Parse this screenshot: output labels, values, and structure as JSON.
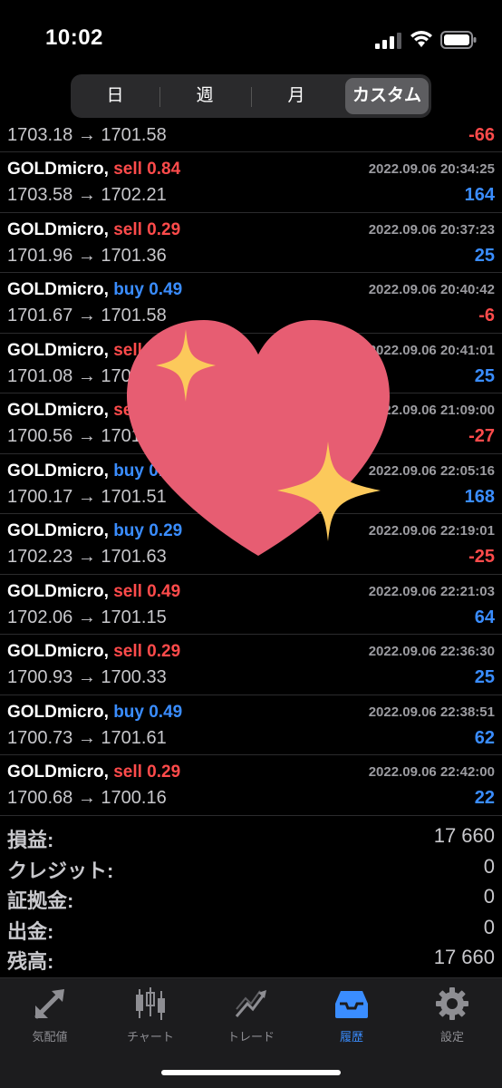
{
  "status_bar": {
    "time": "10:02"
  },
  "segments": [
    {
      "label": "日",
      "active": false
    },
    {
      "label": "週",
      "active": false
    },
    {
      "label": "月",
      "active": false
    },
    {
      "label": "カスタム",
      "active": true
    }
  ],
  "first_row": {
    "prices": "1703.18 → 1701.58",
    "pnl": "-66"
  },
  "trades": [
    {
      "symbol": "GOLDmicro,",
      "side": "sell 0.84",
      "side_type": "sell",
      "time": "2022.09.06 20:34:25",
      "prices": "1703.58 → 1702.21",
      "pnl": "164"
    },
    {
      "symbol": "GOLDmicro,",
      "side": "sell 0.29",
      "side_type": "sell",
      "time": "2022.09.06 20:37:23",
      "prices": "1701.96 → 1701.36",
      "pnl": "25"
    },
    {
      "symbol": "GOLDmicro,",
      "side": "buy 0.49",
      "side_type": "buy",
      "time": "2022.09.06 20:40:42",
      "prices": "1701.67 → 1701.58",
      "pnl": "-6"
    },
    {
      "symbol": "GOLDmicro,",
      "side": "sell 0.29",
      "side_type": "sell",
      "time": "2022.09.06 20:41:01",
      "prices": "1701.08 → 1700.48",
      "pnl": "25"
    },
    {
      "symbol": "GOLDmicro,",
      "side": "sell 0.49",
      "side_type": "sell",
      "time": "2022.09.06 21:09:00",
      "prices": "1700.56 → 1701.11",
      "pnl": "-27"
    },
    {
      "symbol": "GOLDmicro,",
      "side": "buy 0.29",
      "side_type": "buy",
      "time": "2022.09.06 22:05:16",
      "prices": "1700.17 → 1701.51",
      "pnl": "168"
    },
    {
      "symbol": "GOLDmicro,",
      "side": "buy 0.29",
      "side_type": "buy",
      "time": "2022.09.06 22:19:01",
      "prices": "1702.23 → 1701.63",
      "pnl": "-25"
    },
    {
      "symbol": "GOLDmicro,",
      "side": "sell 0.49",
      "side_type": "sell",
      "time": "2022.09.06 22:21:03",
      "prices": "1702.06 → 1701.15",
      "pnl": "64"
    },
    {
      "symbol": "GOLDmicro,",
      "side": "sell 0.29",
      "side_type": "sell",
      "time": "2022.09.06 22:36:30",
      "prices": "1700.93 → 1700.33",
      "pnl": "25"
    },
    {
      "symbol": "GOLDmicro,",
      "side": "buy 0.49",
      "side_type": "buy",
      "time": "2022.09.06 22:38:51",
      "prices": "1700.73 → 1701.61",
      "pnl": "62"
    },
    {
      "symbol": "GOLDmicro,",
      "side": "sell 0.29",
      "side_type": "sell",
      "time": "2022.09.06 22:42:00",
      "prices": "1700.68 → 1700.16",
      "pnl": "22"
    }
  ],
  "summary": [
    {
      "label": "損益:",
      "value": "17 660"
    },
    {
      "label": "クレジット:",
      "value": "0"
    },
    {
      "label": "証拠金:",
      "value": "0"
    },
    {
      "label": "出金:",
      "value": "0"
    },
    {
      "label": "残高:",
      "value": "17 660"
    }
  ],
  "tabs": [
    {
      "label": "気配値",
      "icon": "quotes-arrows-icon",
      "active": false
    },
    {
      "label": "チャート",
      "icon": "candlestick-chart-icon",
      "active": false
    },
    {
      "label": "トレード",
      "icon": "trade-trend-icon",
      "active": false
    },
    {
      "label": "履歴",
      "icon": "history-inbox-icon",
      "active": true
    },
    {
      "label": "設定",
      "icon": "gear-icon",
      "active": false
    }
  ],
  "colors": {
    "sell": "#ff4b4b",
    "buy": "#3a8dff",
    "background": "#000000",
    "accent": "#3a8dff"
  },
  "sticker": "sparkling-heart-icon"
}
